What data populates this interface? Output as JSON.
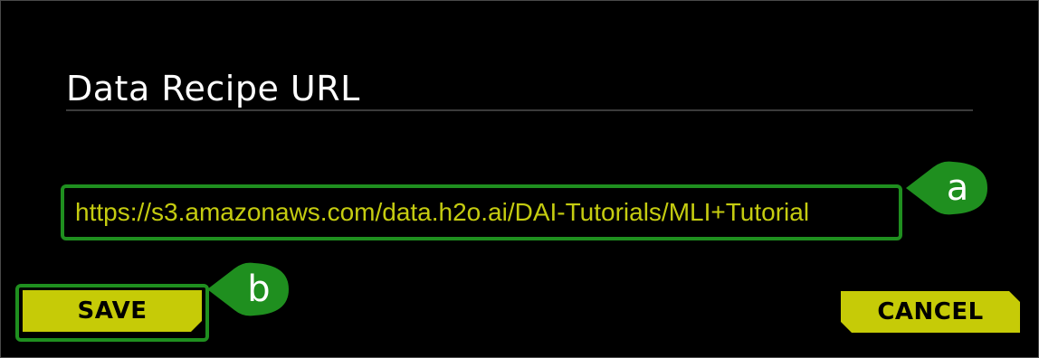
{
  "dialog": {
    "title": "Data Recipe URL",
    "url_input": {
      "value": "https://s3.amazonaws.com/data.h2o.ai/DAI-Tutorials/MLI+Tutorial",
      "visible_value": "https://s3.amazonaws.com/data.h2o.ai/DAI-Tutorials/MLI+Tutor"
    },
    "save_label": "SAVE",
    "cancel_label": "CANCEL"
  },
  "annotations": {
    "a": "a",
    "b": "b"
  },
  "colors": {
    "background": "#000000",
    "accent": "#c6cb07",
    "input_text": "#c5cc10",
    "highlight_green": "#1f8f1f"
  }
}
